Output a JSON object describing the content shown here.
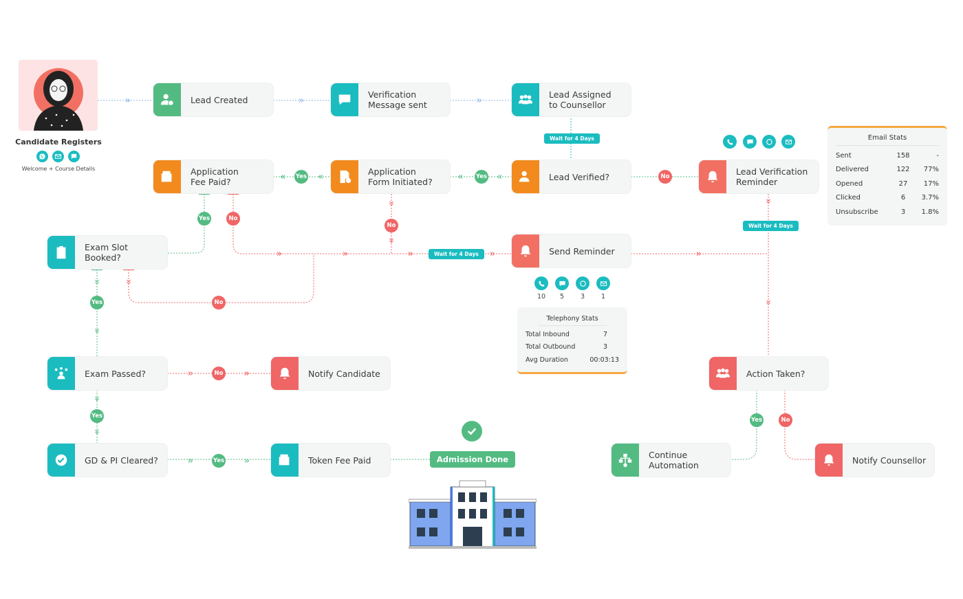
{
  "candidate": {
    "title": "Candidate Registers",
    "subtitle": "Welcome + Course Details",
    "channels": [
      "whatsapp-icon",
      "email-icon",
      "chat-icon"
    ]
  },
  "nodes": {
    "lead_created": "Lead Created",
    "verification_sent": "Verification\nMessage sent",
    "lead_assigned": "Lead Assigned\nto Counsellor",
    "lead_verified": "Lead Verified?",
    "lead_verification_reminder": "Lead Verification\nReminder",
    "app_form": "Application\nForm Initiated?",
    "app_fee": "Application\nFee Paid?",
    "exam_slot": "Exam Slot\nBooked?",
    "send_reminder": "Send Reminder",
    "exam_passed": "Exam Passed?",
    "notify_candidate": "Notify Candidate",
    "gd_pi": "GD & PI Cleared?",
    "token_fee": "Token Fee Paid",
    "action_taken": "Action Taken?",
    "continue_automation": "Continue\nAutomation",
    "notify_counsellor": "Notify Counsellor"
  },
  "labels": {
    "yes": "Yes",
    "no": "No",
    "wait": "Wait for 4 Days"
  },
  "admission": {
    "label": "Admission Done"
  },
  "reminder_counts": {
    "call": "10",
    "sms": "5",
    "whatsapp": "3",
    "email": "1"
  },
  "telephony_stats": {
    "title": "Telephony Stats",
    "rows": [
      {
        "label": "Total Inbound",
        "value": "7"
      },
      {
        "label": "Total Outbound",
        "value": "3"
      },
      {
        "label": "Avg Duration",
        "value": "00:03:13"
      }
    ]
  },
  "email_stats": {
    "title": "Email Stats",
    "rows": [
      {
        "label": "Sent",
        "count": "158",
        "pct": "-"
      },
      {
        "label": "Delivered",
        "count": "122",
        "pct": "77%"
      },
      {
        "label": "Opened",
        "count": "27",
        "pct": "17%"
      },
      {
        "label": "Clicked",
        "count": "6",
        "pct": "3.7%"
      },
      {
        "label": "Unsubscribe",
        "count": "3",
        "pct": "1.8%"
      }
    ]
  },
  "colors": {
    "teal": "#1bbcc0",
    "green": "#53bb82",
    "orange": "#f28a1e",
    "red": "#f06565",
    "accent_bar": "#f5a742"
  }
}
